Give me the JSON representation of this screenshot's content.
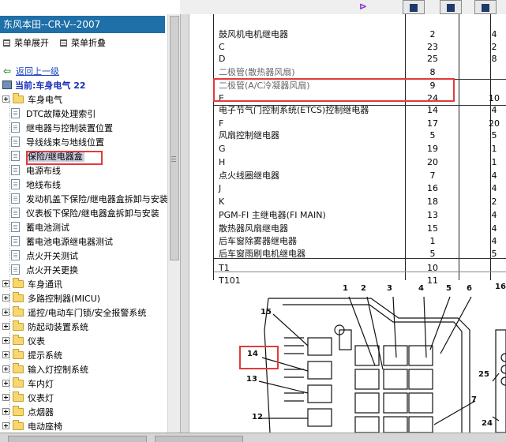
{
  "left_panel": {
    "title": "东风本田--CR-V--2007",
    "expand_all": "菜单展开",
    "collapse_all": "菜单折叠",
    "back_link": "返回上一级",
    "current": "当前:车身电气 22",
    "tree": [
      {
        "label": "车身电气",
        "level": 1,
        "type": "folder"
      },
      {
        "label": "DTC故障处理索引",
        "level": 2,
        "type": "doc"
      },
      {
        "label": "继电器与控制装置位置",
        "level": 2,
        "type": "doc"
      },
      {
        "label": "导线线束与地线位置",
        "level": 2,
        "type": "doc"
      },
      {
        "label": "保险/继电器盒",
        "level": 2,
        "type": "doc",
        "selected": true
      },
      {
        "label": "电源布线",
        "level": 2,
        "type": "doc"
      },
      {
        "label": "地线布线",
        "level": 2,
        "type": "doc"
      },
      {
        "label": "发动机盖下保险/继电器盒拆卸与安装",
        "level": 2,
        "type": "doc"
      },
      {
        "label": "仪表板下保险/继电器盒拆卸与安装",
        "level": 2,
        "type": "doc"
      },
      {
        "label": "蓄电池测试",
        "level": 2,
        "type": "doc"
      },
      {
        "label": "蓄电池电源继电器测试",
        "level": 2,
        "type": "doc"
      },
      {
        "label": "点火开关测试",
        "level": 2,
        "type": "doc"
      },
      {
        "label": "点火开关更换",
        "level": 2,
        "type": "doc"
      },
      {
        "label": "车身通讯",
        "level": 1,
        "type": "folder"
      },
      {
        "label": "多路控制器(MICU)",
        "level": 1,
        "type": "folder"
      },
      {
        "label": "遥控/电动车门锁/安全报警系统",
        "level": 1,
        "type": "folder"
      },
      {
        "label": "防起动装置系统",
        "level": 1,
        "type": "folder"
      },
      {
        "label": "仪表",
        "level": 1,
        "type": "folder"
      },
      {
        "label": "提示系统",
        "level": 1,
        "type": "folder"
      },
      {
        "label": "输入灯控制系统",
        "level": 1,
        "type": "folder"
      },
      {
        "label": "车内灯",
        "level": 1,
        "type": "folder"
      },
      {
        "label": "仪表灯",
        "level": 1,
        "type": "folder"
      },
      {
        "label": "点烟器",
        "level": 1,
        "type": "folder"
      },
      {
        "label": "电动座椅",
        "level": 1,
        "type": "folder"
      }
    ]
  },
  "table": {
    "rows": [
      {
        "name": "鼓风机电机继电器",
        "a": "2",
        "b": "4",
        "fade": false
      },
      {
        "name": "C",
        "a": "23",
        "b": "2",
        "fade": false
      },
      {
        "name": "D",
        "a": "25",
        "b": "8",
        "fade": false
      },
      {
        "name": "二极管(散热器风扇)",
        "a": "8",
        "b": "",
        "fade": true
      },
      {
        "name": "二极管(A/C冷凝器风扇)",
        "a": "9",
        "b": "",
        "fade": true
      },
      {
        "name": "E",
        "a": "24",
        "b": "10",
        "fade": false
      },
      {
        "name": "电子节气门控制系统(ETCS)控制继电器",
        "a": "14",
        "b": "4",
        "fade": false
      },
      {
        "name": "F",
        "a": "17",
        "b": "20",
        "fade": false
      },
      {
        "name": "风扇控制继电器",
        "a": "5",
        "b": "5",
        "fade": false
      },
      {
        "name": "G",
        "a": "19",
        "b": "1",
        "fade": false
      },
      {
        "name": "H",
        "a": "20",
        "b": "1",
        "fade": false
      },
      {
        "name": "点火线圈继电器",
        "a": "7",
        "b": "4",
        "fade": false
      },
      {
        "name": "J",
        "a": "16",
        "b": "4",
        "fade": false
      },
      {
        "name": "K",
        "a": "18",
        "b": "2",
        "fade": false
      },
      {
        "name": "PGM-FI 主继电器(FI MAIN)",
        "a": "13",
        "b": "4",
        "fade": false
      },
      {
        "name": "散热器风扇继电器",
        "a": "15",
        "b": "4",
        "fade": false
      },
      {
        "name": "后车窗除雾器继电器",
        "a": "1",
        "b": "4",
        "fade": false
      },
      {
        "name": "后车窗雨刷电机继电器",
        "a": "5",
        "b": "5",
        "fade": false
      },
      {
        "name": "T1",
        "a": "10",
        "b": "",
        "fade": false
      },
      {
        "name": "T101",
        "a": "11",
        "b": "",
        "fade": false
      }
    ]
  },
  "diagram": {
    "callouts": [
      "1",
      "2",
      "3",
      "4",
      "5",
      "6",
      "16",
      "15",
      "14",
      "13",
      "12",
      "7",
      "25",
      "24"
    ]
  }
}
